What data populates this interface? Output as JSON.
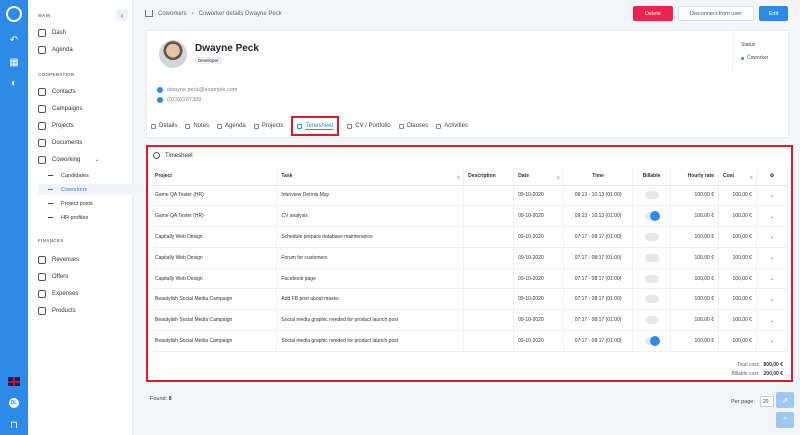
{
  "sidebar": {
    "sections": [
      "MAIN",
      "COOPERATION",
      "FINANCES"
    ],
    "main_items": [
      "Dash",
      "Agenda"
    ],
    "coop_items": [
      "Contacts",
      "Campaigns",
      "Projects",
      "Documents",
      "Coworking"
    ],
    "coworking_sub": [
      "Candidates",
      "Coworkers",
      "Project posts",
      "HR profiles"
    ],
    "finance_items": [
      "Revenues",
      "Offers",
      "Expenses",
      "Products"
    ]
  },
  "header": {
    "breadcrumb_1": "Coworkers",
    "breadcrumb_sep": "›",
    "breadcrumb_2": "Coworker details Dwayne Peck",
    "delete_label": "Delete",
    "disconnect_label": "Disconnect from user",
    "edit_label": "Edit"
  },
  "profile": {
    "name": "Dwayne Peck",
    "role": "Developer",
    "email": "dwayne.peck@example.com",
    "phone": "(023)2287389",
    "status_label": "Status",
    "status_value": "Coworker"
  },
  "tabs": [
    "Details",
    "Notes",
    "Agenda",
    "Projects",
    "Timesheet",
    "CV / Portfolio",
    "Clauses",
    "Activities"
  ],
  "timesheet": {
    "title": "Timesheet",
    "columns": [
      "Project",
      "Task",
      "Description",
      "Date",
      "Time",
      "Billable",
      "Hourly rate",
      "Cost"
    ],
    "rows": [
      {
        "project": "Game QA Tester (HR)",
        "task": "Interview Dennis May",
        "description": "",
        "date": "09-10-2020",
        "time": "09:13 - 10:13 (01:00)",
        "billable": false,
        "rate": "100,00 €",
        "cost": "100,00 €"
      },
      {
        "project": "Game QA Tester (HR)",
        "task": "CV analysis",
        "description": "",
        "date": "09-10-2020",
        "time": "09:13 - 10:13 (01:00)",
        "billable": true,
        "rate": "100,00 €",
        "cost": "100,00 €"
      },
      {
        "project": "Capitally Web Design",
        "task": "Schedule prepare database maintenance",
        "description": "",
        "date": "09-10-2020",
        "time": "07:17 - 08:17 (01:00)",
        "billable": false,
        "rate": "100,00 €",
        "cost": "100,00 €"
      },
      {
        "project": "Capitally Web Design",
        "task": "Forum for customers",
        "description": "",
        "date": "09-10-2020",
        "time": "07:17 - 08:17 (01:00)",
        "billable": false,
        "rate": "100,00 €",
        "cost": "100,00 €"
      },
      {
        "project": "Capitally Web Design",
        "task": "Facebook page",
        "description": "",
        "date": "09-10-2020",
        "time": "07:17 - 08:17 (01:00)",
        "billable": false,
        "rate": "100,00 €",
        "cost": "100,00 €"
      },
      {
        "project": "Beautylish Social Media Campaign",
        "task": "Add FB post about masks",
        "description": "",
        "date": "09-10-2020",
        "time": "07:17 - 08:17 (01:00)",
        "billable": false,
        "rate": "100,00 €",
        "cost": "100,00 €"
      },
      {
        "project": "Beautylish Social Media Campaign",
        "task": "Social media graphic needed for product launch post",
        "description": "",
        "date": "09-10-2020",
        "time": "07:17 - 08:17 (01:00)",
        "billable": false,
        "rate": "100,00 €",
        "cost": "100,00 €"
      },
      {
        "project": "Beautylish Social Media Campaign",
        "task": "Social media graphic needed for product launch post",
        "description": "",
        "date": "09-10-2020",
        "time": "07:17 - 08:17 (01:00)",
        "billable": true,
        "rate": "100,00 €",
        "cost": "100,00 €"
      }
    ],
    "total_cost_label": "Total cost:",
    "total_cost": "800,00 €",
    "billable_cost_label": "Billable cost:",
    "billable_cost": "200,00 €"
  },
  "footer": {
    "found_label": "Found:",
    "found_count": "8",
    "per_page_label": "Per page:",
    "per_page_value": "20"
  },
  "language_flag": "uk-flag",
  "user_initials": "DL"
}
